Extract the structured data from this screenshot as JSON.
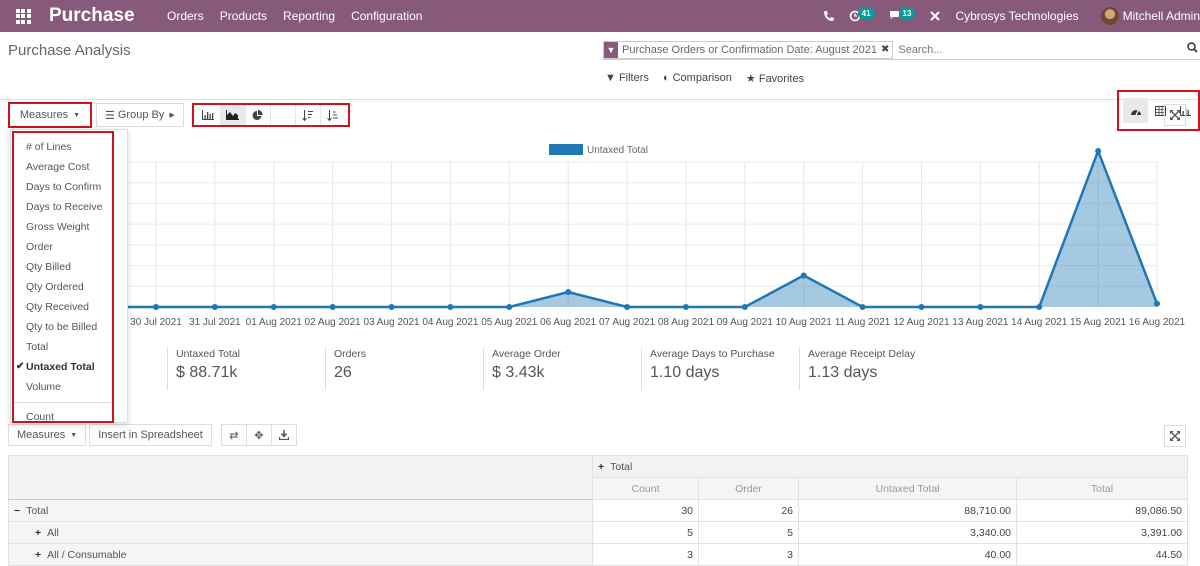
{
  "topbar": {
    "app_name": "Purchase",
    "menu": [
      "Orders",
      "Products",
      "Reporting",
      "Configuration"
    ],
    "activity_count": "41",
    "messages_count": "13",
    "company": "Cybrosys Technologies",
    "user": "Mitchell Admin",
    "brand_color": "#875a7b"
  },
  "control_panel": {
    "title": "Purchase Analysis",
    "facet": "Purchase Orders or Confirmation Date: August 2021",
    "search_placeholder": "Search...",
    "filters_label": "Filters",
    "comparison_label": "Comparison",
    "favorites_label": "Favorites",
    "views": [
      "dashboard",
      "pivot",
      "graph"
    ],
    "active_view": "dashboard"
  },
  "graph_toolbar": {
    "measures_label": "Measures",
    "groupby_label": "Group By",
    "chart_types": [
      "bar",
      "line",
      "pie"
    ],
    "active_chart": "line"
  },
  "measures_menu": {
    "items": [
      "# of Lines",
      "Average Cost",
      "Days to Confirm",
      "Days to Receive",
      "Gross Weight",
      "Order",
      "Qty Billed",
      "Qty Ordered",
      "Qty Received",
      "Qty to be Billed",
      "Total",
      "Untaxed Total",
      "Volume"
    ],
    "selected": "Untaxed Total",
    "extra": "Count"
  },
  "chart_data": {
    "type": "area",
    "title": "",
    "legend": [
      "Untaxed Total"
    ],
    "legend_position": "top",
    "series_color": "#1f77b4",
    "x": [
      "30 Jul 2021",
      "31 Jul 2021",
      "01 Aug 2021",
      "02 Aug 2021",
      "03 Aug 2021",
      "04 Aug 2021",
      "05 Aug 2021",
      "06 Aug 2021",
      "07 Aug 2021",
      "08 Aug 2021",
      "09 Aug 2021",
      "10 Aug 2021",
      "11 Aug 2021",
      "12 Aug 2021",
      "13 Aug 2021",
      "14 Aug 2021",
      "15 Aug 2021",
      "16 Aug 2021"
    ],
    "series": [
      {
        "name": "Untaxed Total",
        "relative_values": [
          0,
          0,
          0,
          0,
          0,
          0,
          0,
          0.09,
          0,
          0,
          0,
          0.19,
          0,
          0,
          0,
          0,
          0.94,
          0.02
        ]
      }
    ],
    "values_note": "No y-axis tick labels are shown; relative_values are heights as a fraction of the unlabeled axis range (0 to 1), estimated from the rendered marks.",
    "estimated_values_if_total_88710": {
      "06 Aug 2021": 6450,
      "10 Aug 2021": 13380,
      "15 Aug 2021": 67390,
      "16 Aug 2021": 1490
    },
    "estimated_values_note": "Derived by assuming the non-zero points sum to the 88,710 Untaxed Total shown in the pivot table; not read from the chart.",
    "gridlines": 7,
    "grid": true,
    "xlabel": "",
    "ylabel": ""
  },
  "kpis": [
    {
      "label": "Untaxed Total",
      "value": "$ 88.71k"
    },
    {
      "label": "Orders",
      "value": "26"
    },
    {
      "label": "Average Order",
      "value": "$ 3.43k"
    },
    {
      "label": "Average Days to Purchase",
      "value": "1.10 days"
    },
    {
      "label": "Average Receipt Delay",
      "value": "1.13 days"
    }
  ],
  "pivot": {
    "measures_label": "Measures",
    "spreadsheet_label": "Insert in Spreadsheet",
    "col_header": "Total",
    "measures": [
      "Count",
      "Order",
      "Untaxed Total",
      "Total"
    ],
    "rows": [
      {
        "label": "Total",
        "expanded": true,
        "values": [
          "30",
          "26",
          "88,710.00",
          "89,086.50"
        ]
      },
      {
        "label": "All",
        "expanded": false,
        "values": [
          "5",
          "5",
          "3,340.00",
          "3,391.00"
        ]
      },
      {
        "label": "All / Consumable",
        "expanded": false,
        "values": [
          "3",
          "3",
          "40.00",
          "44.50"
        ]
      }
    ]
  }
}
